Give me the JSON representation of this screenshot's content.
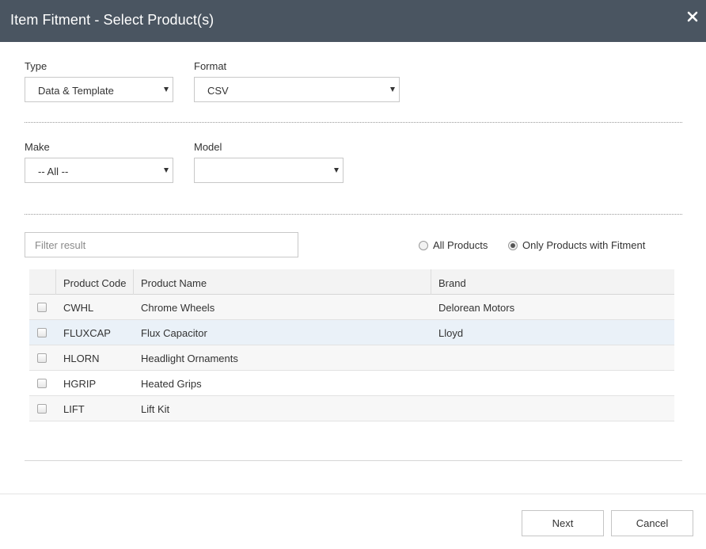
{
  "dialog": {
    "title": "Item Fitment - Select Product(s)",
    "close_icon": "close-icon"
  },
  "type_field": {
    "label": "Type",
    "value": "Data & Template"
  },
  "format_field": {
    "label": "Format",
    "value": "CSV"
  },
  "make_field": {
    "label": "Make",
    "value": "-- All --"
  },
  "model_field": {
    "label": "Model",
    "value": ""
  },
  "filter": {
    "placeholder": "Filter result",
    "value": ""
  },
  "product_scope": {
    "options": [
      {
        "label": "All Products",
        "selected": false
      },
      {
        "label": "Only Products with Fitment",
        "selected": true
      }
    ]
  },
  "table": {
    "columns": [
      "Product Code",
      "Product Name",
      "Brand"
    ],
    "rows": [
      {
        "code": "CWHL",
        "name": "Chrome Wheels",
        "brand": "Delorean Motors",
        "checked": false
      },
      {
        "code": "FLUXCAP",
        "name": "Flux Capacitor",
        "brand": "Lloyd",
        "checked": false
      },
      {
        "code": "HLORN",
        "name": "Headlight Ornaments",
        "brand": "",
        "checked": false
      },
      {
        "code": "HGRIP",
        "name": "Heated Grips",
        "brand": "",
        "checked": false
      },
      {
        "code": "LIFT",
        "name": "Lift Kit",
        "brand": "",
        "checked": false
      }
    ]
  },
  "buttons": {
    "next": "Next",
    "cancel": "Cancel"
  },
  "colors": {
    "titlebar": "#4a5561",
    "selected_row": "#eaf1f8"
  }
}
